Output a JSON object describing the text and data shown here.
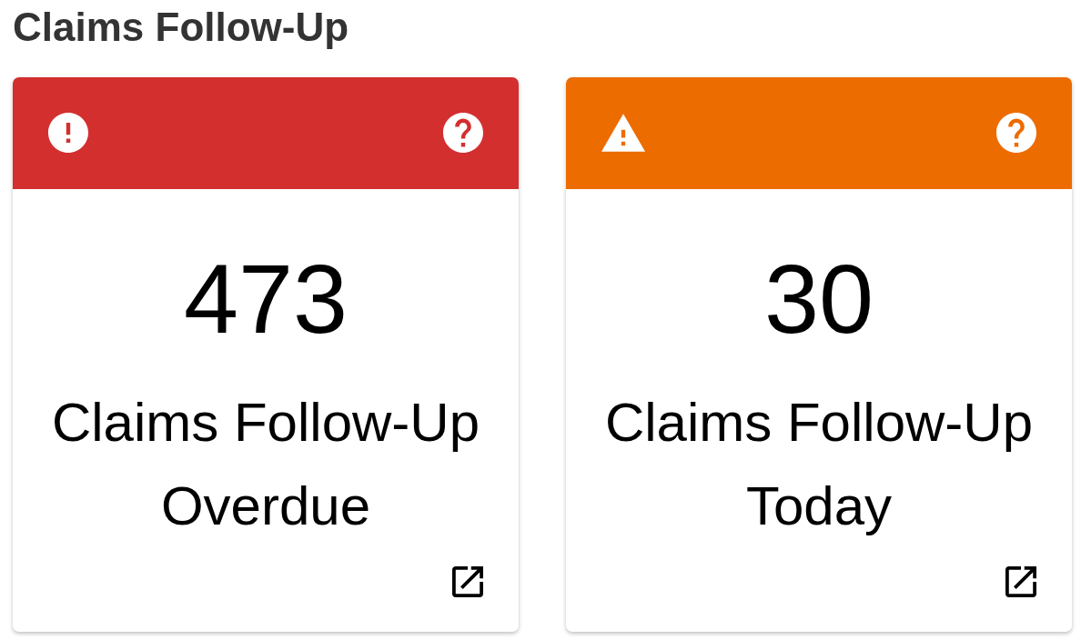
{
  "page": {
    "title": "Claims Follow-Up"
  },
  "cards": [
    {
      "kind": "error",
      "color": "#d32f2f",
      "count": "473",
      "label": "Claims Follow-Up Overdue"
    },
    {
      "kind": "warning",
      "color": "#ec6c00",
      "count": "30",
      "label": "Claims Follow-Up Today"
    }
  ]
}
